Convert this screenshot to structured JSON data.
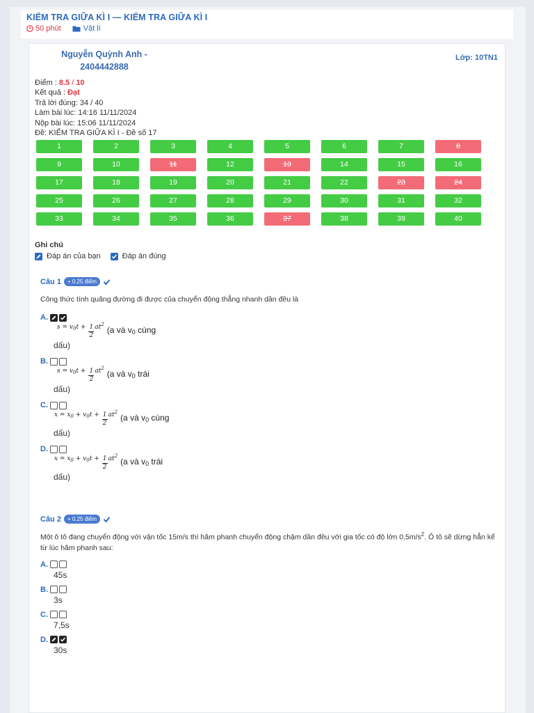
{
  "header": {
    "title": "KIỂM TRA GIỮA KÌ I — KIỂM TRA GIỮA KÌ I",
    "duration": "50 phút",
    "subject": "Vật lí"
  },
  "student": {
    "name_line1": "Nguyễn Quỳnh Anh -",
    "name_line2": "2404442888",
    "class": "Lớp: 10TN1"
  },
  "result": {
    "score_label": "Điểm : ",
    "score": "8.5",
    "score_sep": " / ",
    "score_max": "10",
    "outcome_label": "Kết quả : ",
    "outcome": "Đạt",
    "correct": "Trả lời đúng: 34 / 40",
    "started": "Làm bài lúc: 14:16 11/11/2024",
    "submitted": "Nộp bài lúc: 15:06 11/11/2024",
    "exam": "Đề: KIỂM TRA GIỮA KÌ I - Đề số 17"
  },
  "grid": {
    "cells": [
      {
        "n": "1",
        "ok": true
      },
      {
        "n": "2",
        "ok": true
      },
      {
        "n": "3",
        "ok": true
      },
      {
        "n": "4",
        "ok": true
      },
      {
        "n": "5",
        "ok": true
      },
      {
        "n": "6",
        "ok": true
      },
      {
        "n": "7",
        "ok": true
      },
      {
        "n": "8",
        "ok": false
      },
      {
        "n": "9",
        "ok": true
      },
      {
        "n": "10",
        "ok": true
      },
      {
        "n": "11",
        "ok": false
      },
      {
        "n": "12",
        "ok": true
      },
      {
        "n": "13",
        "ok": false
      },
      {
        "n": "14",
        "ok": true
      },
      {
        "n": "15",
        "ok": true
      },
      {
        "n": "16",
        "ok": true
      },
      {
        "n": "17",
        "ok": true
      },
      {
        "n": "18",
        "ok": true
      },
      {
        "n": "19",
        "ok": true
      },
      {
        "n": "20",
        "ok": true
      },
      {
        "n": "21",
        "ok": true
      },
      {
        "n": "22",
        "ok": true
      },
      {
        "n": "23",
        "ok": false
      },
      {
        "n": "24",
        "ok": false
      },
      {
        "n": "25",
        "ok": true
      },
      {
        "n": "26",
        "ok": true
      },
      {
        "n": "27",
        "ok": true
      },
      {
        "n": "28",
        "ok": true
      },
      {
        "n": "29",
        "ok": true
      },
      {
        "n": "30",
        "ok": true
      },
      {
        "n": "31",
        "ok": true
      },
      {
        "n": "32",
        "ok": true
      },
      {
        "n": "33",
        "ok": true
      },
      {
        "n": "34",
        "ok": true
      },
      {
        "n": "35",
        "ok": true
      },
      {
        "n": "36",
        "ok": true
      },
      {
        "n": "37",
        "ok": false
      },
      {
        "n": "38",
        "ok": true
      },
      {
        "n": "39",
        "ok": true
      },
      {
        "n": "40",
        "ok": true
      }
    ],
    "colors": {
      "correct": "#44cc44",
      "wrong": "#f26b76"
    }
  },
  "note": {
    "heading": "Ghi chú",
    "your_answer": "Đáp án của bạn",
    "correct_answer": "Đáp án đúng"
  },
  "questions": [
    {
      "label": "Câu 1",
      "points": "+ 0.25 điểm",
      "text": "Công thức tính quãng đường đi được của chuyển động thẳng nhanh dần đều là",
      "options": [
        {
          "letter": "A.",
          "formula_lead": "s = v",
          "formula_mid": "t + ",
          "text_a": "(a và v",
          "text_b": " cùng",
          "text_c": "dấu)"
        },
        {
          "letter": "B.",
          "formula_lead": "s = v",
          "formula_mid": "t + ",
          "text_a": "(a và v",
          "text_b": " trái",
          "text_c": "dấu)"
        },
        {
          "letter": "C.",
          "formula_lead": "x = x",
          "formula_mid": " + v",
          "text_a": "(a và v",
          "text_b": " cùng",
          "text_c": "dấu)"
        },
        {
          "letter": "D.",
          "formula_lead": "x = x",
          "formula_mid": " + v",
          "text_a": "(a và v",
          "text_b": " trái",
          "text_c": "dấu)"
        }
      ]
    },
    {
      "label": "Câu 2",
      "points": "+ 0.25 điểm",
      "text": "Một ô tô đang chuyển động với vận tốc 15m/s thì hãm phanh chuyển động chậm dần đều với gia tốc có độ lớn 0,5m/s",
      "text_sup": "2",
      "text_tail": ". Ô tô sẽ dừng hẳn kể từ lúc hãm phanh sau:",
      "options": [
        {
          "letter": "A.",
          "value": "45s"
        },
        {
          "letter": "B.",
          "value": "3s"
        },
        {
          "letter": "C.",
          "value": "7,5s"
        },
        {
          "letter": "D.",
          "value": "30s"
        }
      ]
    }
  ],
  "math": {
    "sub0": "0",
    "one": "1",
    "two": "2",
    "at": "at",
    "sup2": "2",
    "t": "t"
  }
}
